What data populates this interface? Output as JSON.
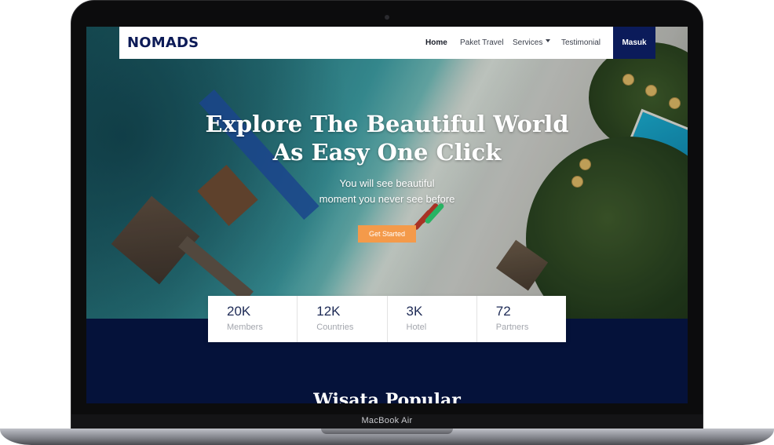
{
  "device": {
    "model_label": "MacBook Air"
  },
  "nav": {
    "logo": "NOMADS",
    "links": [
      {
        "label": "Home",
        "active": true
      },
      {
        "label": "Paket Travel",
        "active": false
      },
      {
        "label": "Services",
        "active": false
      },
      {
        "label": "Testimonial",
        "active": false
      }
    ],
    "login_label": "Masuk"
  },
  "hero": {
    "title_line1": "Explore The Beautiful World",
    "title_line2": "As Easy One Click",
    "subtitle_line1": "You will see beautiful",
    "subtitle_line2": "moment you never see before",
    "cta_label": "Get Started"
  },
  "stats": [
    {
      "value": "20K",
      "label": "Members"
    },
    {
      "value": "12K",
      "label": "Countries"
    },
    {
      "value": "3K",
      "label": "Hotel"
    },
    {
      "value": "72",
      "label": "Partners"
    }
  ],
  "section": {
    "title": "Wisata Popular"
  },
  "colors": {
    "brand_navy": "#0b1b5a",
    "cta_orange": "#f49a4a",
    "section_bg": "#05123a"
  }
}
